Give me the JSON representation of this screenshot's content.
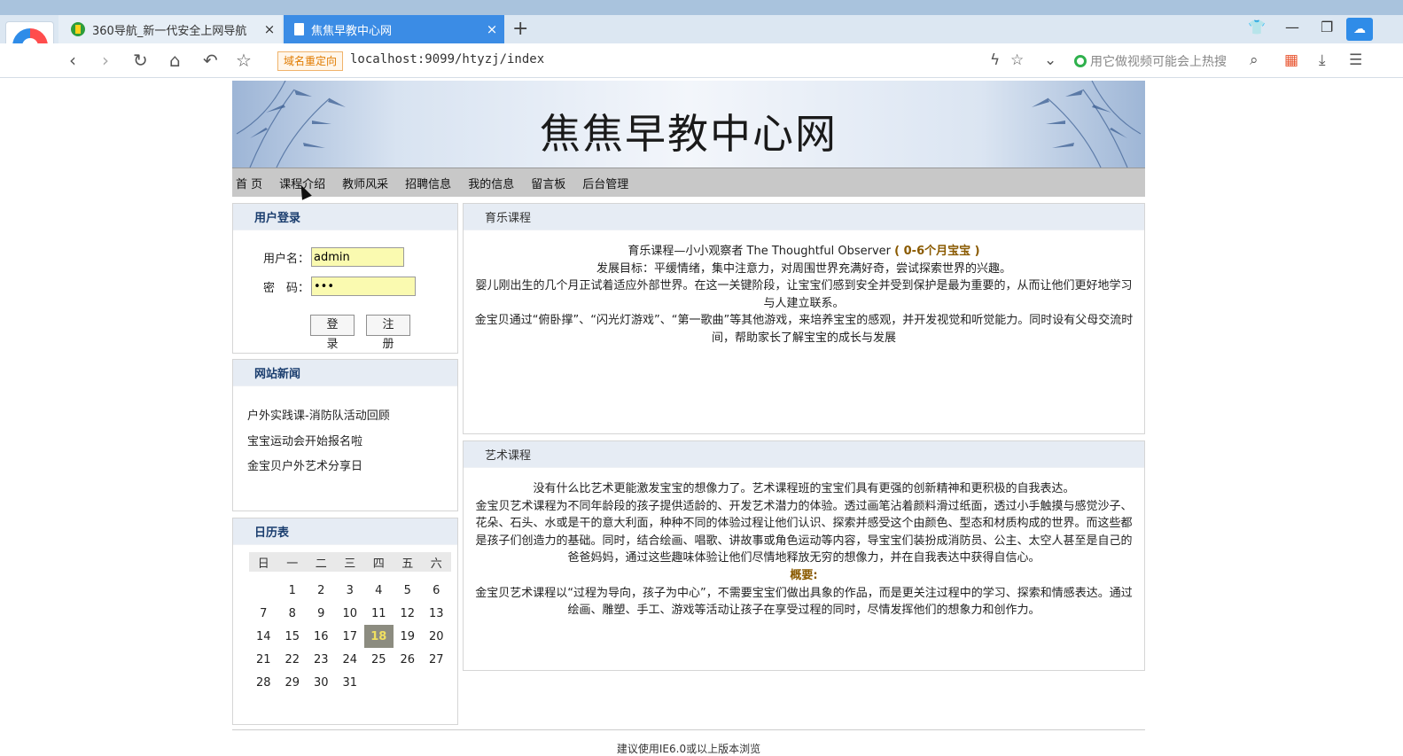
{
  "browser": {
    "tabs": [
      {
        "title": "360导航_新一代安全上网导航",
        "close": "×"
      },
      {
        "title": "焦焦早教中心网",
        "close": "×"
      }
    ],
    "new_tab": "+",
    "redirect_badge": "域名重定向",
    "url": "localhost:9099/htyzj/index",
    "search_placeholder": "用它做视频可能会上热搜"
  },
  "site": {
    "title": "焦焦早教中心网",
    "nav": [
      "首 页",
      "课程介绍",
      "教师风采",
      "招聘信息",
      "我的信息",
      "留言板",
      "后台管理"
    ]
  },
  "login": {
    "title": "用户登录",
    "username_label": "用户名：",
    "username_value": "admin",
    "password_label": "密　码：",
    "password_value": "•••",
    "login_button": "登 录",
    "register_button": "注 册"
  },
  "news": {
    "title": "网站新闻",
    "items": [
      "户外实践课-消防队活动回顾",
      "宝宝运动会开始报名啦",
      "金宝贝户外艺术分享日"
    ]
  },
  "calendar": {
    "title": "日历表",
    "weekdays": [
      "日",
      "一",
      "二",
      "三",
      "四",
      "五",
      "六"
    ],
    "weeks": [
      [
        "",
        "1",
        "2",
        "3",
        "4",
        "5",
        "6"
      ],
      [
        "7",
        "8",
        "9",
        "10",
        "11",
        "12",
        "13"
      ],
      [
        "14",
        "15",
        "16",
        "17",
        "18",
        "19",
        "20"
      ],
      [
        "21",
        "22",
        "23",
        "24",
        "25",
        "26",
        "27"
      ],
      [
        "28",
        "29",
        "30",
        "31",
        "",
        "",
        ""
      ]
    ],
    "today": "18"
  },
  "music": {
    "title": "育乐课程",
    "line1": "育乐课程—小小观察者 The Thoughtful Observer",
    "line1_highlight": "( 0-6个月宝宝 )",
    "line2": "发展目标：平缓情绪，集中注意力，对周围世界充满好奇，尝试探索世界的兴趣。",
    "line3": "婴儿刚出生的几个月正试着适应外部世界。在这一关键阶段，让宝宝们感到安全并受到保护是最为重要的，从而让他们更好地学习与人建立联系。",
    "line4": "金宝贝通过“俯卧撑”、“闪光灯游戏”、“第一歌曲”等其他游戏，来培养宝宝的感观，并开发视觉和听觉能力。同时设有父母交流时间，帮助家长了解宝宝的成长与发展"
  },
  "art": {
    "title": "艺术课程",
    "line1": "没有什么比艺术更能激发宝宝的想像力了。艺术课程班的宝宝们具有更强的创新精神和更积极的自我表达。",
    "line2": "金宝贝艺术课程为不同年龄段的孩子提供适龄的、开发艺术潜力的体验。透过画笔沾着颜料滑过纸面，透过小手触摸与感觉沙子、花朵、石头、水或是干的意大利面，种种不同的体验过程让他们认识、探索并感受这个由颜色、型态和材质构成的世界。而这些都是孩子们创造力的基础。同时，结合绘画、唱歌、讲故事或角色运动等内容，导宝宝们装扮成消防员、公主、太空人甚至是自己的爸爸妈妈，通过这些趣味体验让他们尽情地释放无穷的想像力，并在自我表达中获得自信心。",
    "summary_label": "概要:",
    "line3": "金宝贝艺术课程以“过程为导向，孩子为中心”，不需要宝宝们做出具象的作品，而是更关注过程中的学习、探索和情感表达。通过绘画、雕塑、手工、游戏等活动让孩子在享受过程的同时，尽情发挥他们的想象力和创作力。"
  },
  "footer": {
    "text": "建议使用IE6.0或以上版本浏览"
  }
}
